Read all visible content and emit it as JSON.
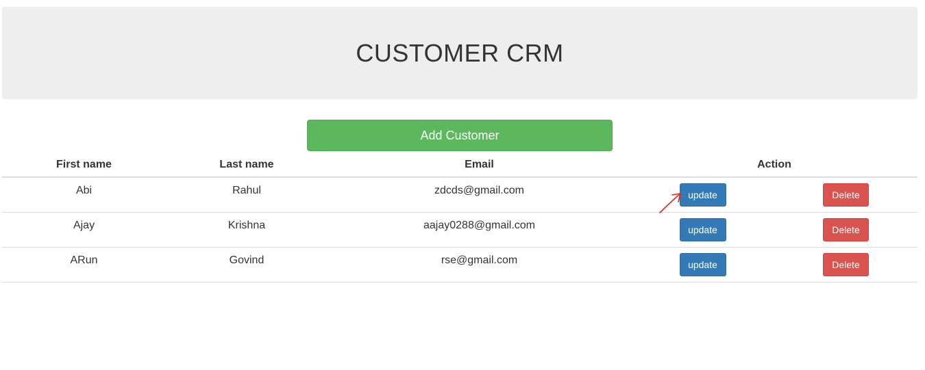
{
  "header": {
    "title": "CUSTOMER CRM"
  },
  "add_button_label": "Add Customer",
  "table": {
    "columns": [
      "First name",
      "Last name",
      "Email",
      "Action"
    ],
    "rows": [
      {
        "first": "Abi",
        "last": "Rahul",
        "email": "zdcds@gmail.com",
        "update": "update",
        "delete": "Delete"
      },
      {
        "first": "Ajay",
        "last": "Krishna",
        "email": "aajay0288@gmail.com",
        "update": "update",
        "delete": "Delete"
      },
      {
        "first": "ARun",
        "last": "Govind",
        "email": "rse@gmail.com",
        "update": "update",
        "delete": "Delete"
      }
    ]
  },
  "colors": {
    "header_bg": "#eeeeee",
    "add_button": "#5cb85c",
    "update_button": "#337ab7",
    "delete_button": "#d9534f",
    "annotation_arrow": "#e8201c"
  },
  "annotation": {
    "icon": "red-arrow-icon"
  }
}
